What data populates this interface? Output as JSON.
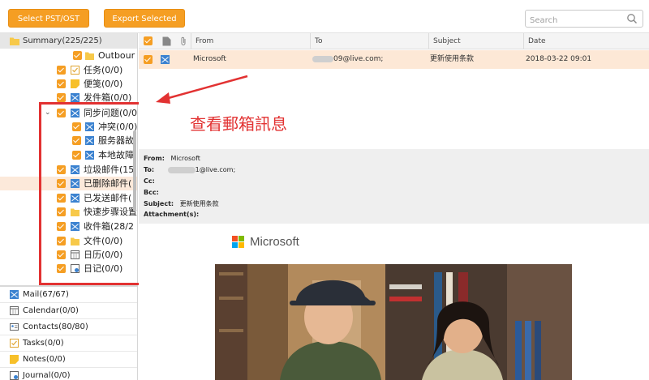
{
  "toolbar": {
    "select_label": "Select PST/OST",
    "export_label": "Export Selected",
    "search_placeholder": "Search"
  },
  "tree": {
    "summary": "Summary(225/225)",
    "items": [
      {
        "label": "Outbour"
      },
      {
        "label": "任务(0/0)"
      },
      {
        "label": "便笺(0/0)"
      },
      {
        "label": "发件箱(0/0)"
      },
      {
        "label": "同步问题(0/0"
      },
      {
        "label": "冲突(0/0)"
      },
      {
        "label": "服务器故"
      },
      {
        "label": "本地故障"
      },
      {
        "label": "垃圾邮件(15,"
      },
      {
        "label": "已删除邮件("
      },
      {
        "label": "已发送邮件("
      },
      {
        "label": "快速步骤设置"
      },
      {
        "label": "收件箱(28/2"
      },
      {
        "label": "文件(0/0)"
      },
      {
        "label": "日历(0/0)"
      },
      {
        "label": "日记(0/0)"
      }
    ]
  },
  "nav": {
    "items": [
      {
        "label": "Mail(67/67)"
      },
      {
        "label": "Calendar(0/0)"
      },
      {
        "label": "Contacts(80/80)"
      },
      {
        "label": "Tasks(0/0)"
      },
      {
        "label": "Notes(0/0)"
      },
      {
        "label": "Journal(0/0)"
      }
    ]
  },
  "list": {
    "headers": {
      "from": "From",
      "to": "To",
      "subject": "Subject",
      "date": "Date"
    },
    "rows": [
      {
        "from": "Microsoft",
        "to": "09@live.com;",
        "subject": "更新使用条款",
        "date": "2018-03-22 09:01"
      }
    ]
  },
  "annotation": "查看郵箱訊息",
  "preview": {
    "from_label": "From:",
    "from_value": "Microsoft",
    "to_label": "To:",
    "to_value": "1@live.com;",
    "cc_label": "Cc:",
    "bcc_label": "Bcc:",
    "subject_label": "Subject:",
    "subject_value": "更新使用条款",
    "attachments_label": "Attachment(s):"
  },
  "email_body": {
    "brand": "Microsoft"
  },
  "colors": {
    "accent": "#f59e23",
    "highlight": "#e23232",
    "selected_row": "#fde8d6"
  }
}
